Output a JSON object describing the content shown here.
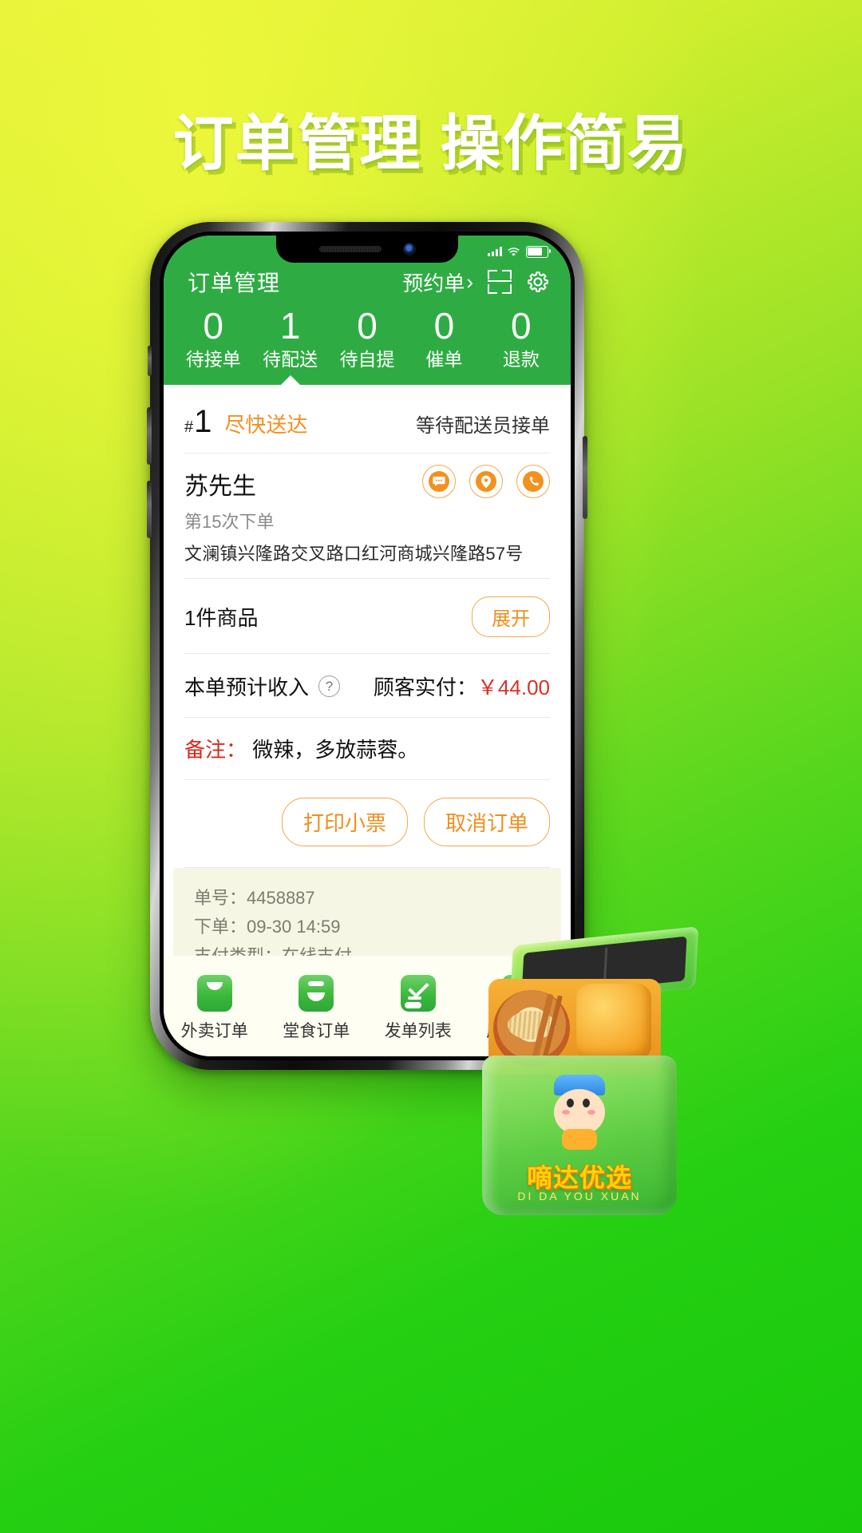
{
  "headline": "订单管理 操作简易",
  "phone": {
    "statusbar": {
      "signal_icon": "signal-bars-icon",
      "wifi_icon": "wifi-icon",
      "battery_icon": "battery-icon"
    },
    "header": {
      "title": "订单管理",
      "reserve_label": "预约单",
      "reserve_chevron": "›",
      "scan_icon": "scan-icon",
      "settings_icon": "gear-icon"
    },
    "stats": [
      {
        "num": "0",
        "label": "待接单",
        "active": false
      },
      {
        "num": "1",
        "label": "待配送",
        "active": true
      },
      {
        "num": "0",
        "label": "待自提",
        "active": false
      },
      {
        "num": "0",
        "label": "催单",
        "active": false
      },
      {
        "num": "0",
        "label": "退款",
        "active": false
      }
    ],
    "order": {
      "hash": "#",
      "seq": "1",
      "urgent_label": "尽快送达",
      "status_text": "等待配送员接单",
      "customer_name": "苏先生",
      "customer_times": "第15次下单",
      "customer_address": "文澜镇兴隆路交叉路口红河商城兴隆路57号",
      "action_icons": [
        "chat-bubble-icon",
        "location-pin-icon",
        "phone-icon"
      ],
      "goods_text": "1件商品",
      "expand_label": "展开",
      "income_label": "本单预计收入",
      "help_icon": "question-mark-icon",
      "paid_label": "顾客实付：",
      "paid_value": "￥44.00",
      "remark_key": "备注：",
      "remark_value": "微辣，多放蒜蓉。",
      "print_label": "打印小票",
      "cancel_label": "取消订单",
      "meta": [
        "单号：4458887",
        "下单：09-30  14:59",
        "支付类型：在线支付"
      ]
    },
    "bottom_nav": [
      {
        "label": "外卖订单",
        "icon": "takeout-bag-icon"
      },
      {
        "label": "堂食订单",
        "icon": "dine-in-bowl-icon"
      },
      {
        "label": "发单列表",
        "icon": "checklist-icon"
      },
      {
        "label": "店铺管理",
        "icon": "shop-icon"
      }
    ]
  },
  "mascot": {
    "brand_cn": "嘀达优选",
    "brand_en": "DI DA YOU XUAN"
  },
  "colors": {
    "brand_green": "#2eac43",
    "accent_orange": "#ef8f1e",
    "price_red": "#d93025",
    "bg_green": "#19c90c"
  }
}
